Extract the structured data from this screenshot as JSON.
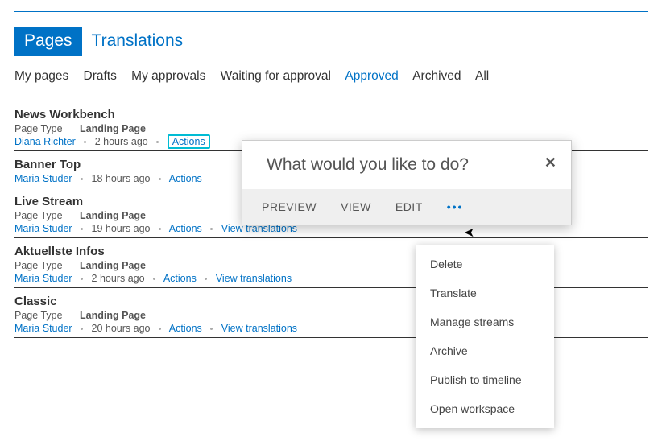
{
  "tabs": {
    "primary": [
      {
        "label": "Pages",
        "active": true
      },
      {
        "label": "Translations",
        "active": false
      }
    ],
    "filters": [
      {
        "label": "My pages",
        "active": false
      },
      {
        "label": "Drafts",
        "active": false
      },
      {
        "label": "My approvals",
        "active": false
      },
      {
        "label": "Waiting for approval",
        "active": false
      },
      {
        "label": "Approved",
        "active": true
      },
      {
        "label": "Archived",
        "active": false
      },
      {
        "label": "All",
        "active": false
      }
    ]
  },
  "meta_labels": {
    "page_type": "Page Type",
    "actions": "Actions",
    "view_translations": "View translations"
  },
  "pages": [
    {
      "title": "News Workbench",
      "page_type": "Landing Page",
      "author": "Diana Richter",
      "ago": "2 hours ago",
      "show_page_type": true,
      "show_view_translations": false,
      "actions_highlighted": true
    },
    {
      "title": "Banner Top",
      "page_type": "",
      "author": "Maria Studer",
      "ago": "18 hours ago",
      "show_page_type": false,
      "show_view_translations": false,
      "actions_highlighted": false
    },
    {
      "title": "Live Stream",
      "page_type": "Landing Page",
      "author": "Maria Studer",
      "ago": "19 hours ago",
      "show_page_type": true,
      "show_view_translations": true,
      "actions_highlighted": false
    },
    {
      "title": "Aktuellste Infos",
      "page_type": "Landing Page",
      "author": "Maria Studer",
      "ago": "2 hours ago",
      "show_page_type": true,
      "show_view_translations": true,
      "actions_highlighted": false
    },
    {
      "title": "Classic",
      "page_type": "Landing Page",
      "author": "Maria Studer",
      "ago": "20 hours ago",
      "show_page_type": true,
      "show_view_translations": true,
      "actions_highlighted": false
    }
  ],
  "popup": {
    "title": "What would you like to do?",
    "actions": [
      {
        "label": "PREVIEW"
      },
      {
        "label": "VIEW"
      },
      {
        "label": "EDIT"
      }
    ],
    "more_glyph": "•••"
  },
  "dropdown": {
    "items": [
      {
        "label": "Delete"
      },
      {
        "label": "Translate"
      },
      {
        "label": "Manage streams"
      },
      {
        "label": "Archive"
      },
      {
        "label": "Publish to timeline"
      },
      {
        "label": "Open workspace"
      }
    ]
  }
}
